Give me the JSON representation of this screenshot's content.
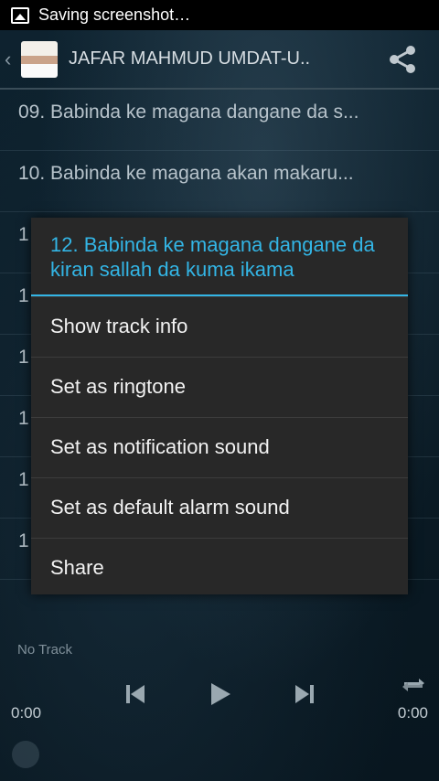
{
  "status": {
    "text": "Saving screenshot…"
  },
  "header": {
    "title": "JAFAR MAHMUD UMDAT-U.."
  },
  "tracks": [
    "09. Babinda ke magana dangane da s...",
    "10. Babinda ke magana akan makaru...",
    "1",
    "1",
    "1",
    "1",
    "1",
    "1"
  ],
  "dialog": {
    "title": "12. Babinda ke magana dangane da kiran sallah da kuma ikama",
    "items": [
      "Show track info",
      "Set as ringtone",
      "Set as notification sound",
      "Set as default alarm sound",
      "Share"
    ]
  },
  "player": {
    "no_track": "No Track",
    "elapsed": "0:00",
    "total": "0:00"
  },
  "colors": {
    "accent": "#33b5e5",
    "dialog_bg": "#282828"
  },
  "icons": [
    "image-icon",
    "back-chevron-icon",
    "share-icon",
    "prev-icon",
    "play-icon",
    "next-icon",
    "repeat-icon"
  ]
}
